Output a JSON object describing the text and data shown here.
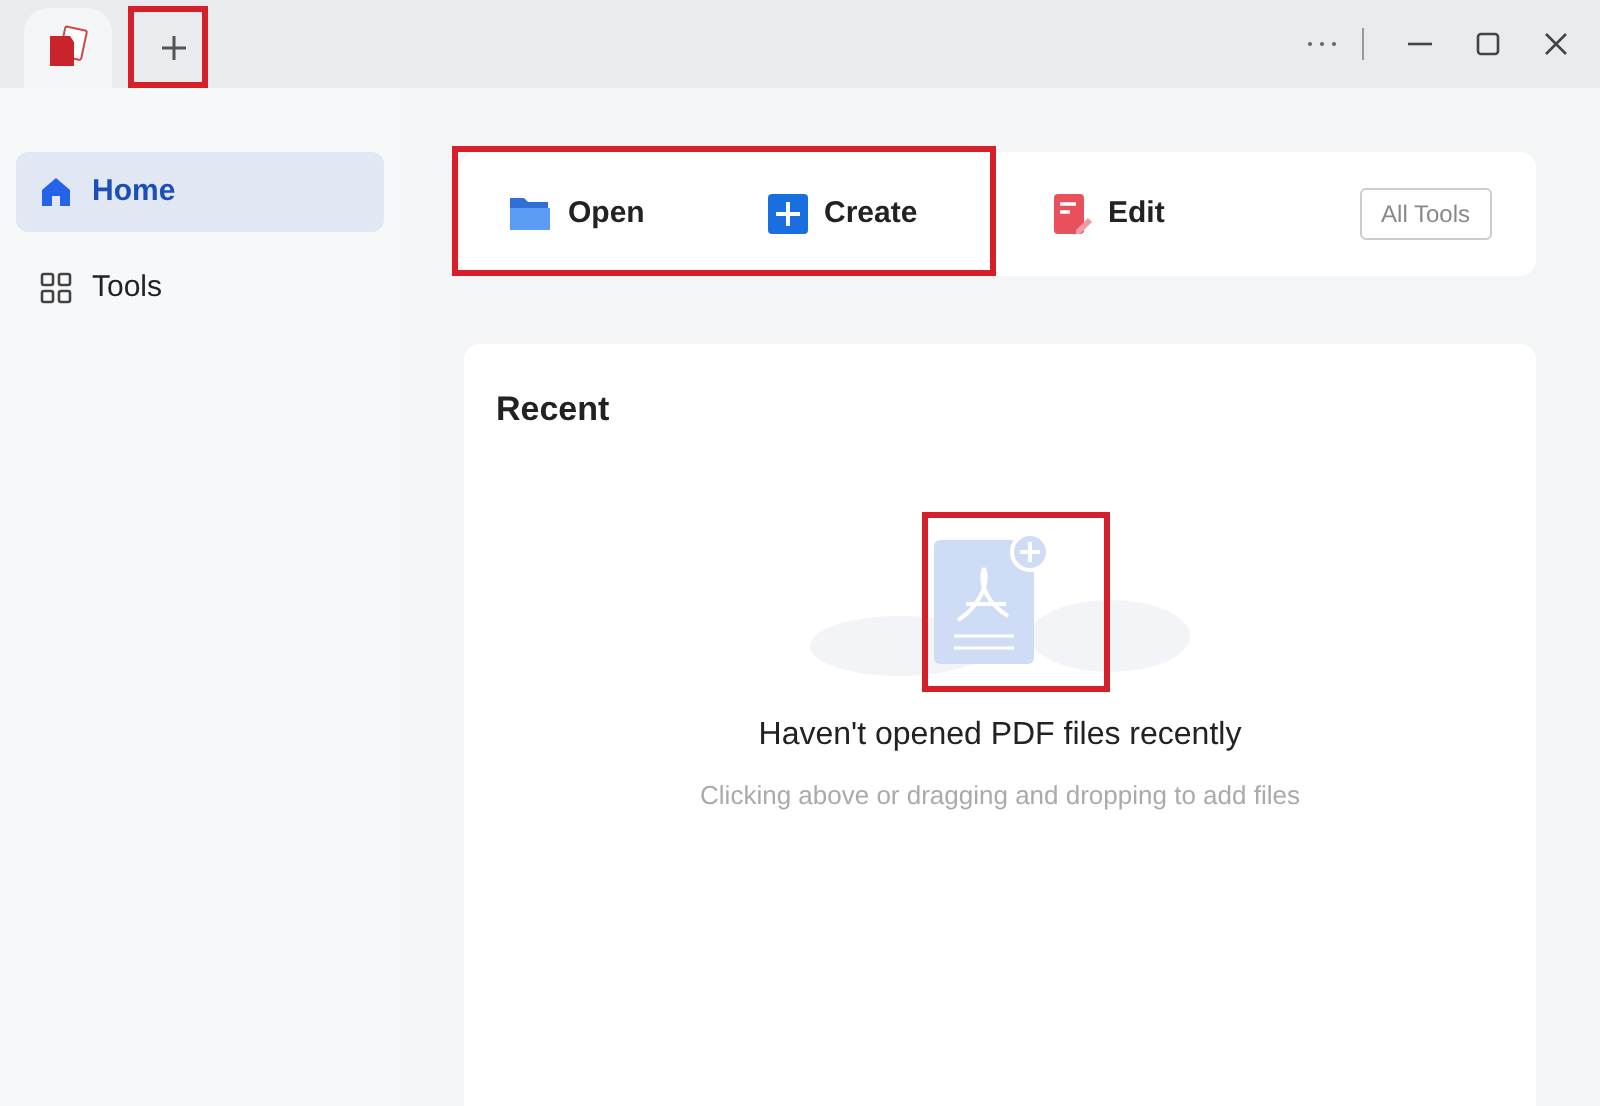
{
  "sidebar": {
    "items": [
      {
        "label": "Home",
        "selected": true
      },
      {
        "label": "Tools",
        "selected": false
      }
    ]
  },
  "toolbar": {
    "actions": [
      {
        "label": "Open"
      },
      {
        "label": "Create"
      },
      {
        "label": "Edit"
      }
    ],
    "all_tools": "All Tools"
  },
  "recent": {
    "title": "Recent",
    "empty_title": "Haven't opened PDF files recently",
    "empty_hint": "Clicking above or dragging and dropping to add files"
  }
}
